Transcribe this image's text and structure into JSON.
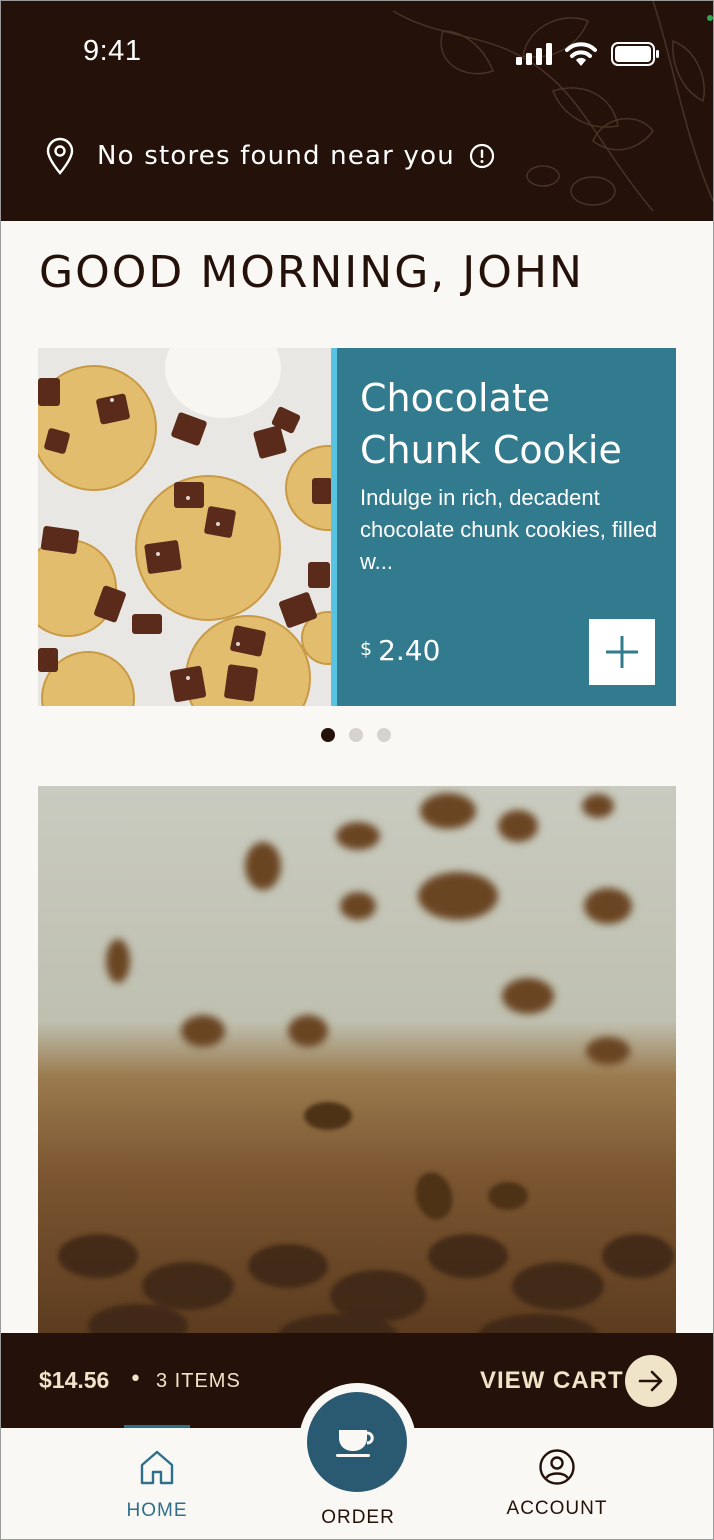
{
  "status_bar": {
    "time": "9:41"
  },
  "header": {
    "location_text": "No stores found near you"
  },
  "greeting": "GOOD MORNING, JOHN",
  "featured": {
    "title_line1": "Chocolate",
    "title_line2": "Chunk Cookie",
    "description": "Indulge in rich, decadent chocolate chunk cookies, filled w...",
    "currency": "$",
    "price": "2.40",
    "carousel_total": 3,
    "carousel_active": 1
  },
  "cart": {
    "total": "$14.56",
    "separator": "•",
    "items": "3 ITEMS",
    "view_cart": "VIEW CART"
  },
  "nav": {
    "home": "HOME",
    "order": "ORDER",
    "account": "ACCOUNT",
    "active": "home"
  },
  "icons": {
    "location": "map-pin-icon",
    "info": "info-icon",
    "add": "plus-icon",
    "arrow": "arrow-right-icon",
    "home": "home-icon",
    "order": "coffee-cup-icon",
    "account": "user-circle-icon"
  },
  "colors": {
    "header_bg": "#241109",
    "card_bg": "#327a8d",
    "accent": "#58c3e3",
    "cart_text": "#efe4c8",
    "nav_active": "#2e6f8a",
    "order_button": "#2a5a72"
  }
}
